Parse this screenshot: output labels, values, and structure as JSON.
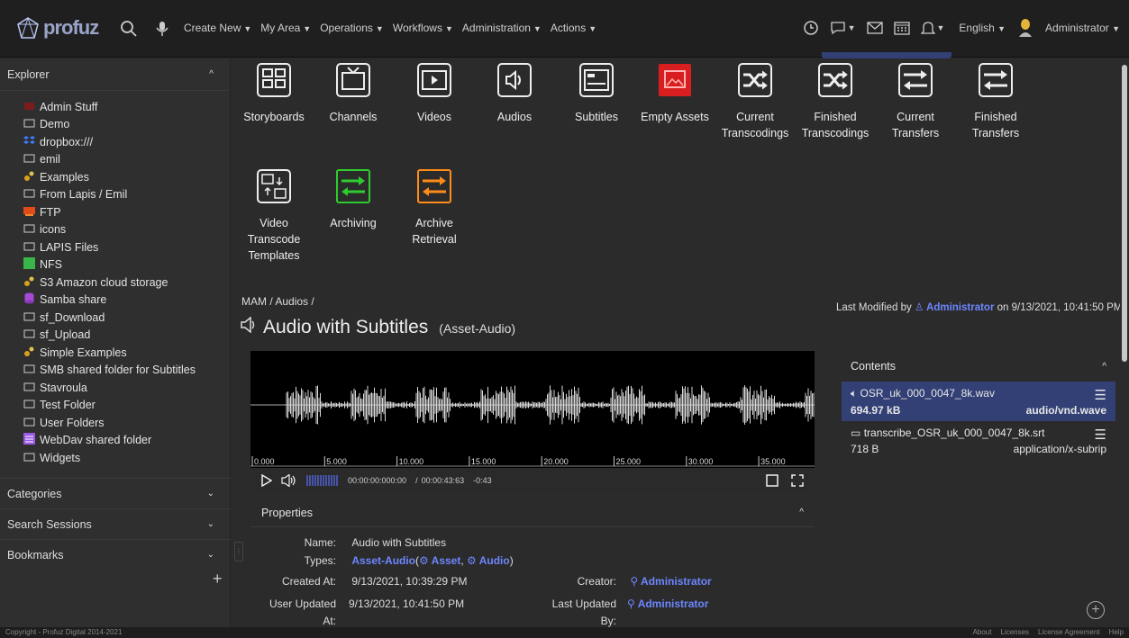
{
  "header": {
    "logo_text": "profuz",
    "menu": [
      "Create New",
      "My Area",
      "Operations",
      "Workflows",
      "Administration",
      "Actions"
    ],
    "language": "English",
    "user": "Administrator"
  },
  "sidebar": {
    "explorer_title": "Explorer",
    "items": [
      {
        "label": "Admin Stuff",
        "icon": "red-folder-icon"
      },
      {
        "label": "Demo",
        "icon": "folder-icon"
      },
      {
        "label": "dropbox:///",
        "icon": "dropbox-icon"
      },
      {
        "label": "emil",
        "icon": "folder-icon"
      },
      {
        "label": "Examples",
        "icon": "gears-icon"
      },
      {
        "label": "From Lapis / Emil",
        "icon": "folder-icon"
      },
      {
        "label": "FTP",
        "icon": "ftp-icon"
      },
      {
        "label": "icons",
        "icon": "folder-icon"
      },
      {
        "label": "LAPIS Files",
        "icon": "folder-icon"
      },
      {
        "label": "NFS",
        "icon": "nfs-icon"
      },
      {
        "label": "S3 Amazon cloud storage",
        "icon": "gears-icon"
      },
      {
        "label": "Samba share",
        "icon": "database-icon"
      },
      {
        "label": "sf_Download",
        "icon": "folder-icon"
      },
      {
        "label": "sf_Upload",
        "icon": "folder-icon"
      },
      {
        "label": "Simple Examples",
        "icon": "gears-icon"
      },
      {
        "label": "SMB shared folder for Subtitles",
        "icon": "folder-icon"
      },
      {
        "label": "Stavroula",
        "icon": "folder-icon"
      },
      {
        "label": "Test Folder",
        "icon": "folder-icon"
      },
      {
        "label": "User Folders",
        "icon": "folder-icon"
      },
      {
        "label": "WebDav shared folder",
        "icon": "webdav-icon"
      },
      {
        "label": "Widgets",
        "icon": "folder-icon"
      }
    ],
    "categories": "Categories",
    "search_sessions": "Search Sessions",
    "bookmarks": "Bookmarks",
    "add": "+"
  },
  "tiles": [
    {
      "label": "Storyboards",
      "icon": "storyboards-icon"
    },
    {
      "label": "Channels",
      "icon": "tv-icon"
    },
    {
      "label": "Videos",
      "icon": "video-play-icon"
    },
    {
      "label": "Audios",
      "icon": "speaker-icon"
    },
    {
      "label": "Subtitles",
      "icon": "subtitles-icon"
    },
    {
      "label": "Empty Assets",
      "icon": "empty-assets-icon"
    },
    {
      "label": "Current Transcodings",
      "icon": "shuffle-icon"
    },
    {
      "label": "Finished Transcodings",
      "icon": "shuffle-icon"
    },
    {
      "label": "Current Transfers",
      "icon": "transfer-icon"
    },
    {
      "label": "Finished Transfers",
      "icon": "transfer-icon"
    },
    {
      "label": "Video Transcode Templates",
      "icon": "transcode-template-icon"
    },
    {
      "label": "Archiving",
      "icon": "archive-transfer-icon"
    },
    {
      "label": "Archive Retrieval",
      "icon": "archive-retrieval-icon"
    }
  ],
  "breadcrumb": "MAM / Audios /",
  "asset": {
    "title": "Audio with Subtitles",
    "type_label": "(Asset-Audio)",
    "last_modified_prefix": "Last Modified by",
    "last_modified_user": "Administrator",
    "last_modified_on": "on 9/13/2021, 10:41:50 PM"
  },
  "timeline": [
    "0.000",
    "5.000",
    "10.000",
    "15.000",
    "20.000",
    "25.000",
    "30.000",
    "35.000"
  ],
  "player": {
    "timecode": "00:00:00:000:00",
    "separator": "/",
    "duration": "00:00:43:63",
    "remaining": "-0:43"
  },
  "properties": {
    "title": "Properties",
    "name_label": "Name:",
    "name_value": "Audio with Subtitles",
    "types_label": "Types:",
    "types_main": "Asset-Audio",
    "types_open": "(",
    "types_sub1": "Asset",
    "types_comma": ",",
    "types_sub2": "Audio",
    "types_close": ")",
    "created_label": "Created At:",
    "created_value": "9/13/2021, 10:39:29 PM",
    "creator_label": "Creator:",
    "creator_value": "Administrator",
    "updated_label_1": "User Updated",
    "updated_label_2": "At:",
    "updated_value": "9/13/2021, 10:41:50 PM",
    "last_updated_label_1": "Last Updated",
    "last_updated_label_2": "By:",
    "last_updated_value": "Administrator"
  },
  "contents": {
    "title": "Contents",
    "items": [
      {
        "name": "OSR_uk_000_0047_8k.wav",
        "size": "694.97 kB",
        "mime": "audio/vnd.wave"
      },
      {
        "name": "transcribe_OSR_uk_000_0047_8k.srt",
        "size": "718 B",
        "mime": "application/x-subrip"
      }
    ]
  },
  "footer": {
    "copyright": "Copyright - Profuz Digital 2014-2021",
    "links": [
      "About",
      "Licenses",
      "License Agreement",
      "Help"
    ]
  },
  "colors": {
    "accent": "#6d86ff",
    "selected": "#324076",
    "green": "#2ecc2e",
    "orange": "#ff8c1a",
    "red": "#d81e1e"
  }
}
